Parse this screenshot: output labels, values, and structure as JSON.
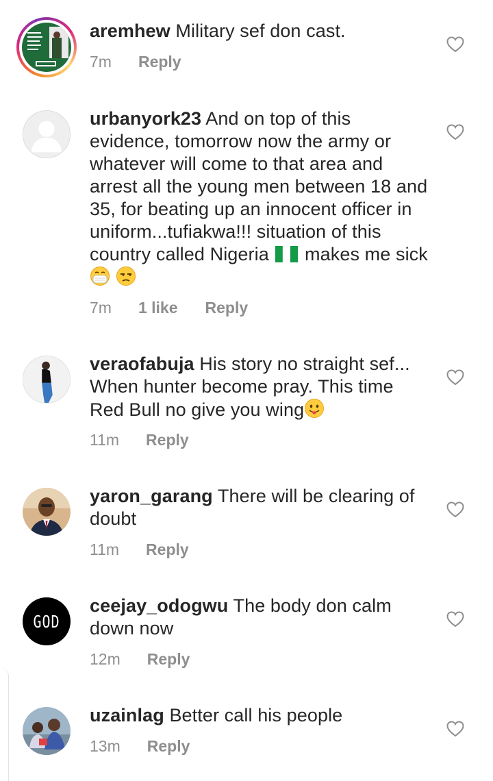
{
  "comments": [
    {
      "username": "aremhew",
      "text": "Military sef don cast.",
      "time": "7m",
      "reply_label": "Reply",
      "avatar": "story-ring-photo"
    },
    {
      "username": "urbanyork23",
      "text_before_flag": "And on top of this evidence, tomorrow now the army or whatever will come to that area and arrest all the young men between 18 and 35, for beating up an innocent officer in uniform...tufiakwa!!! situation of this country called Nigeria",
      "text_after_flag": "makes me sick",
      "emojis": [
        "mask-face",
        "unamused-face"
      ],
      "time": "7m",
      "likes": "1 like",
      "reply_label": "Reply",
      "avatar": "default-silhouette"
    },
    {
      "username": "veraofabuja",
      "text": "His story no straight sef... When hunter become pray. This time Red Bull no give you wing",
      "emojis": [
        "tongue-face"
      ],
      "time": "11m",
      "reply_label": "Reply",
      "avatar": "person-photo"
    },
    {
      "username": "yaron_garang",
      "text": "There will be clearing of doubt",
      "time": "11m",
      "reply_label": "Reply",
      "avatar": "man-suit-photo"
    },
    {
      "username": "ceejay_odogwu",
      "text": "The body don calm down now",
      "time": "12m",
      "reply_label": "Reply",
      "avatar": "god-text-logo",
      "avatar_text": "GOD"
    },
    {
      "username": "uzainlag",
      "text": "Better call his people",
      "time": "13m",
      "reply_label": "Reply",
      "avatar": "group-photo"
    }
  ],
  "colors": {
    "text": "#262626",
    "meta": "#8e8e8e",
    "heart": "#8e8e8e"
  },
  "icons": {
    "like": "heart-outline-icon"
  }
}
